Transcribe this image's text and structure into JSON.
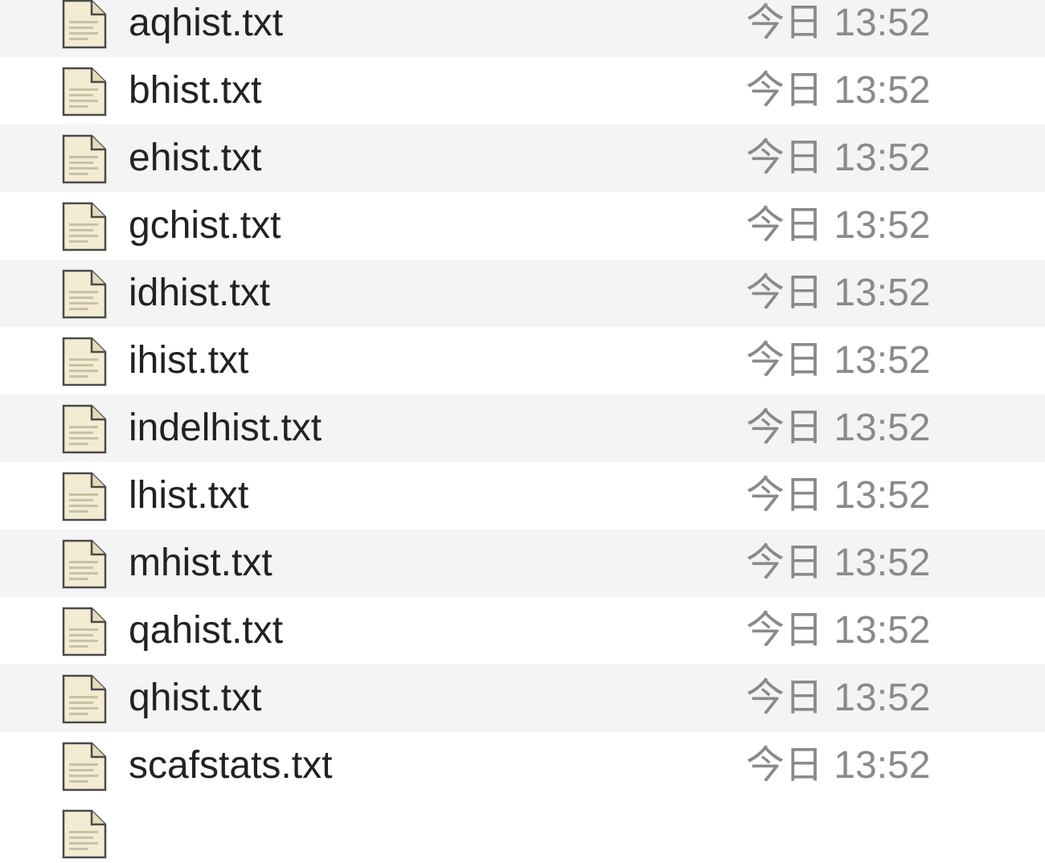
{
  "files": [
    {
      "name": "aqhist.txt",
      "date": "今日 13:52",
      "icon": "text-document-icon"
    },
    {
      "name": "bhist.txt",
      "date": "今日 13:52",
      "icon": "text-document-icon"
    },
    {
      "name": "ehist.txt",
      "date": "今日 13:52",
      "icon": "text-document-icon"
    },
    {
      "name": "gchist.txt",
      "date": "今日 13:52",
      "icon": "text-document-icon"
    },
    {
      "name": "idhist.txt",
      "date": "今日 13:52",
      "icon": "text-document-icon"
    },
    {
      "name": "ihist.txt",
      "date": "今日 13:52",
      "icon": "text-document-icon"
    },
    {
      "name": "indelhist.txt",
      "date": "今日 13:52",
      "icon": "text-document-icon"
    },
    {
      "name": "lhist.txt",
      "date": "今日 13:52",
      "icon": "text-document-icon"
    },
    {
      "name": "mhist.txt",
      "date": "今日 13:52",
      "icon": "text-document-icon"
    },
    {
      "name": "qahist.txt",
      "date": "今日 13:52",
      "icon": "text-document-icon"
    },
    {
      "name": "qhist.txt",
      "date": "今日 13:52",
      "icon": "text-document-icon"
    },
    {
      "name": "scafstats.txt",
      "date": "今日 13:52",
      "icon": "text-document-icon"
    }
  ],
  "colors": {
    "row_alt": "#f4f4f5",
    "row_plain": "#ffffff",
    "name_text": "#222222",
    "date_text": "#8a8a8a"
  }
}
